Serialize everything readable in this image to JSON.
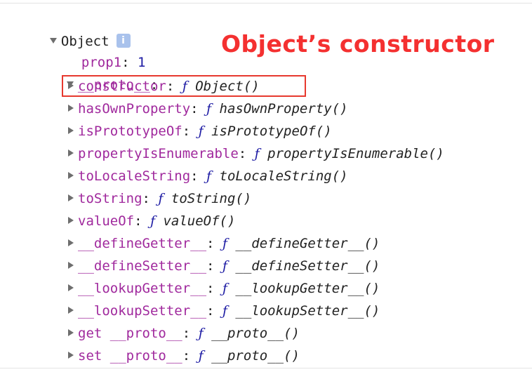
{
  "root": {
    "label": "Object",
    "info_icon": "i"
  },
  "prop1": {
    "key": "prop1",
    "value": "1"
  },
  "proto": {
    "key": "__proto__"
  },
  "annotation": "Object’s constructor",
  "members": [
    {
      "key": "constructor",
      "f": "ƒ",
      "name": "Object()"
    },
    {
      "key": "hasOwnProperty",
      "f": "ƒ",
      "name": "hasOwnProperty()"
    },
    {
      "key": "isPrototypeOf",
      "f": "ƒ",
      "name": "isPrototypeOf()"
    },
    {
      "key": "propertyIsEnumerable",
      "f": "ƒ",
      "name": "propertyIsEnumerable()"
    },
    {
      "key": "toLocaleString",
      "f": "ƒ",
      "name": "toLocaleString()"
    },
    {
      "key": "toString",
      "f": "ƒ",
      "name": "toString()"
    },
    {
      "key": "valueOf",
      "f": "ƒ",
      "name": "valueOf()"
    },
    {
      "key": "__defineGetter__",
      "f": "ƒ",
      "name": "__defineGetter__()"
    },
    {
      "key": "__defineSetter__",
      "f": "ƒ",
      "name": "__defineSetter__()"
    },
    {
      "key": "__lookupGetter__",
      "f": "ƒ",
      "name": "__lookupGetter__()"
    },
    {
      "key": "__lookupSetter__",
      "f": "ƒ",
      "name": "__lookupSetter__()"
    },
    {
      "key": "get __proto__",
      "f": "ƒ",
      "name": "__proto__()"
    },
    {
      "key": "set __proto__",
      "f": "ƒ",
      "name": "__proto__()"
    }
  ],
  "colors": {
    "key": "#a0299d",
    "number": "#1c1aa3",
    "annotation": "#f43030",
    "highlight": "#e7392e"
  }
}
